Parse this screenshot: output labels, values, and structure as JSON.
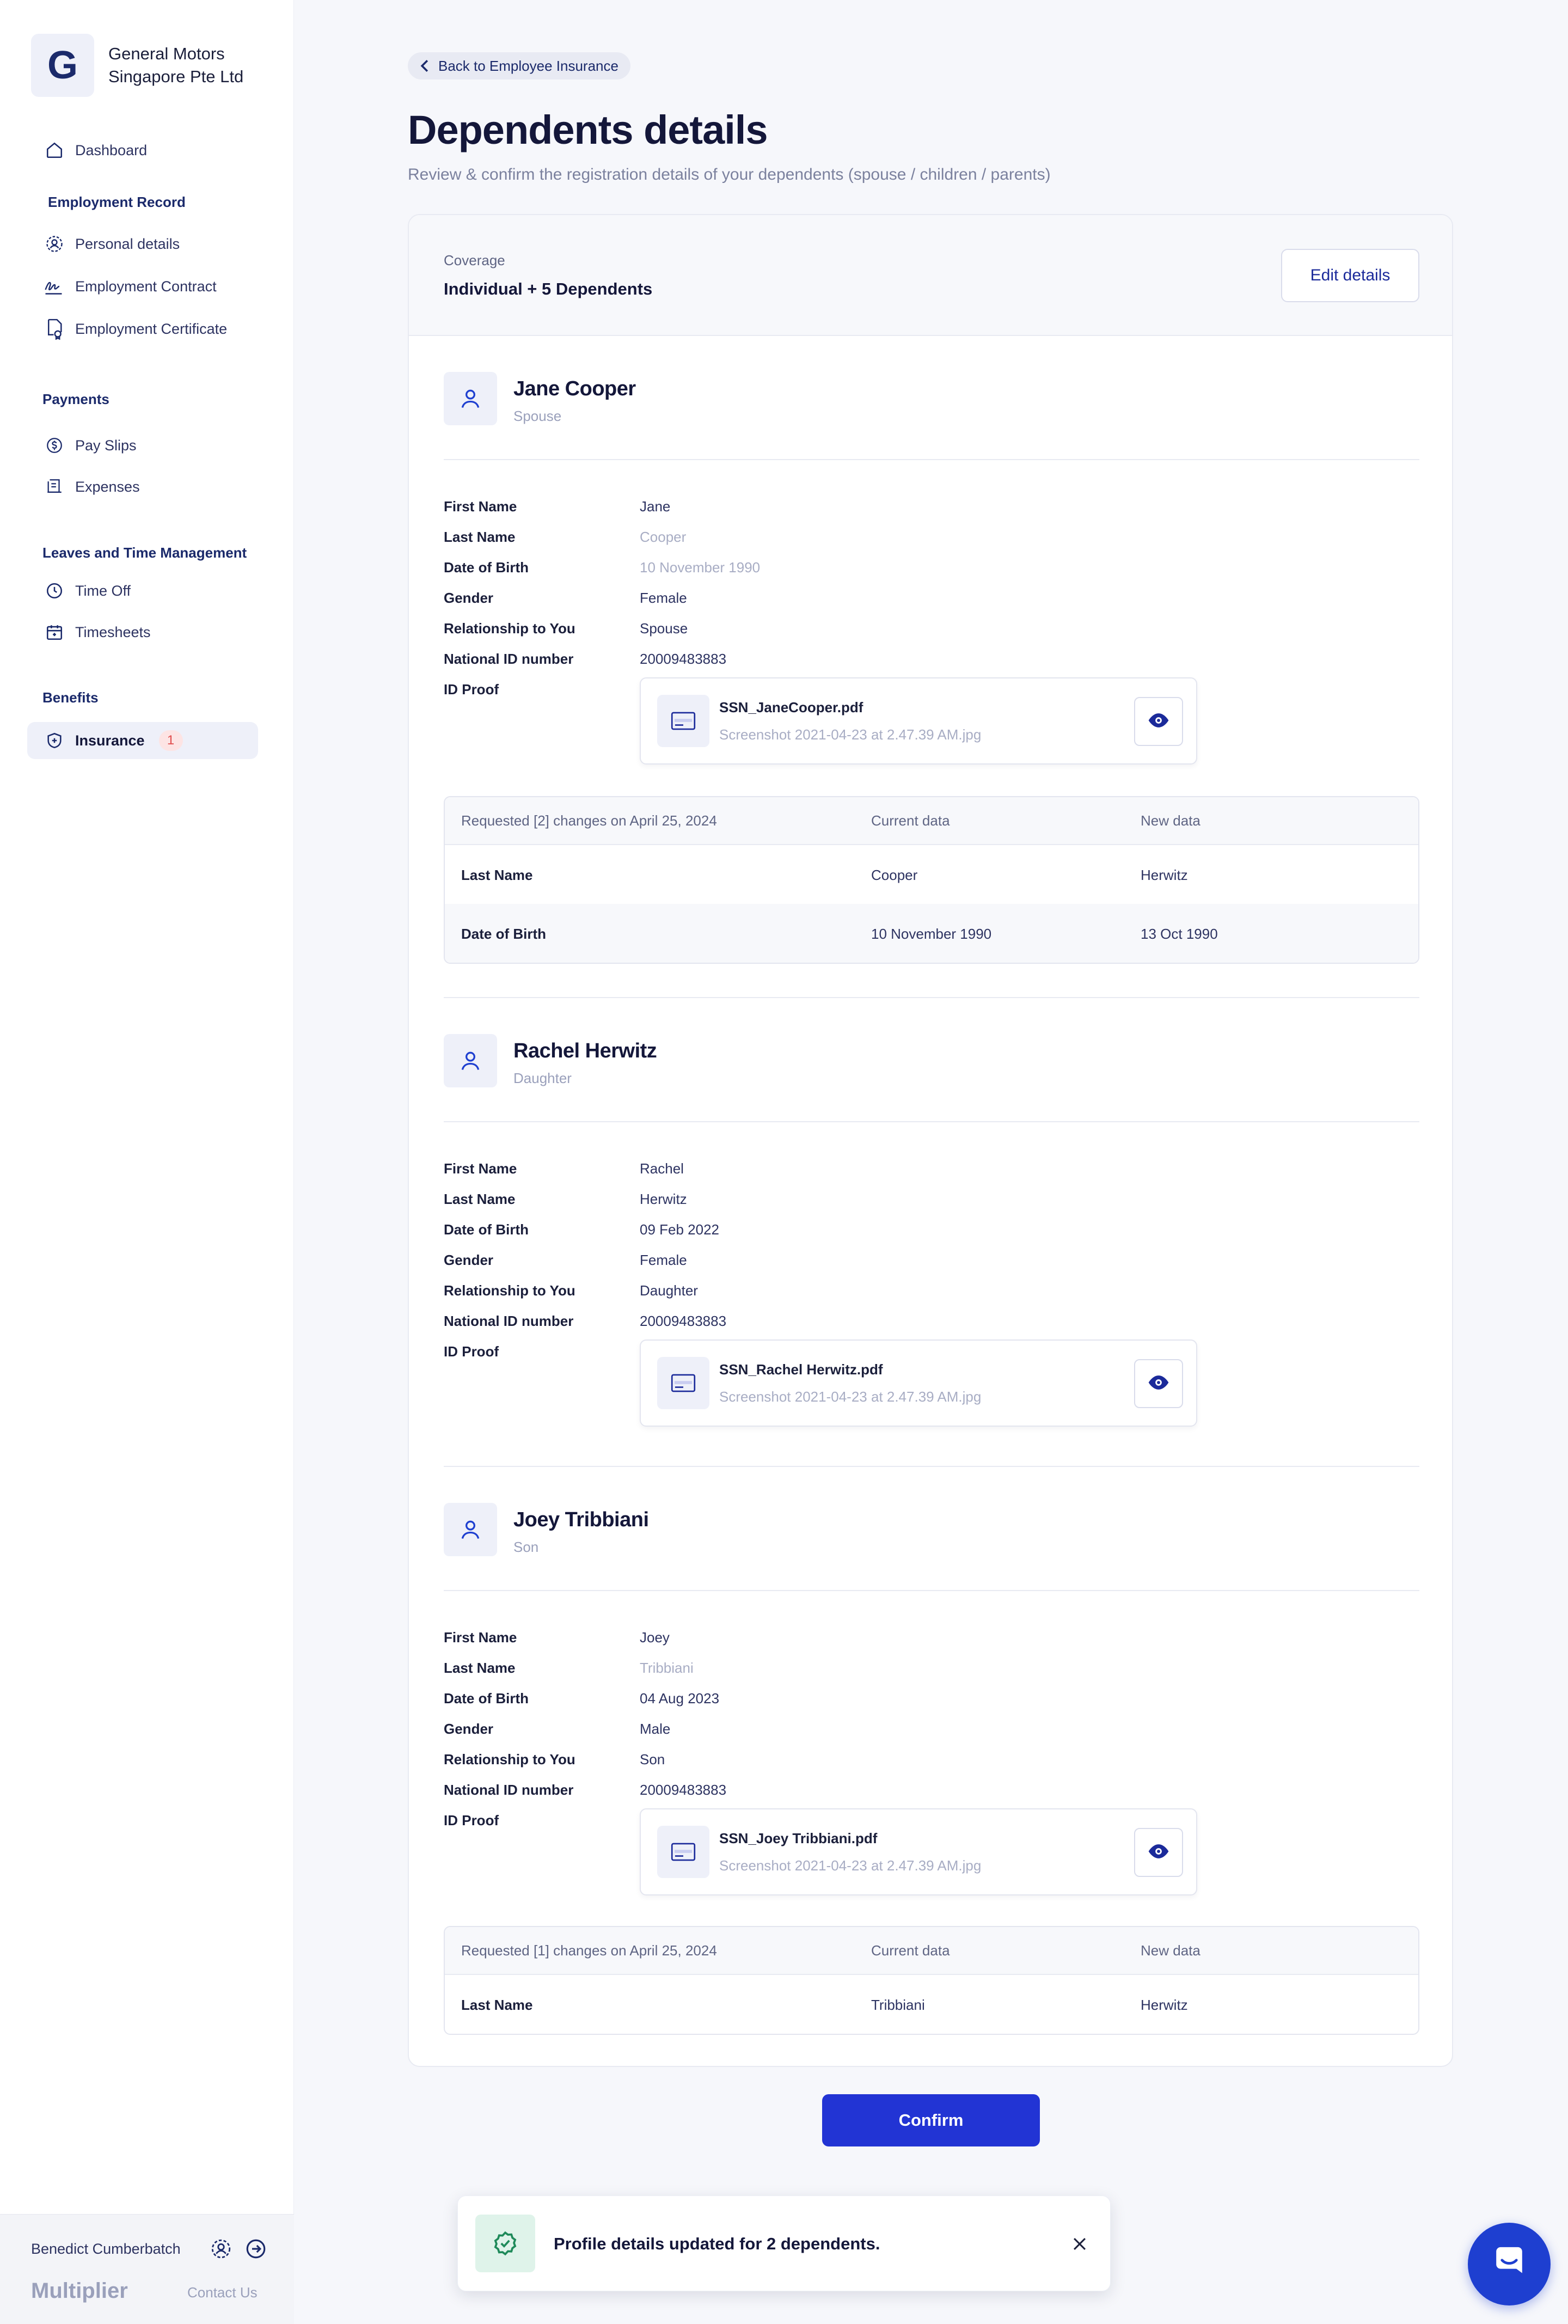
{
  "company": {
    "logo_letter": "G",
    "name_line1": "General Motors",
    "name_line2": "Singapore Pte Ltd"
  },
  "sidebar": {
    "dashboard": "Dashboard",
    "sections": {
      "employment": "Employment Record",
      "payments": "Payments",
      "leaves": "Leaves and Time Management",
      "benefits": "Benefits"
    },
    "items": {
      "personal_details": "Personal details",
      "employment_contract": "Employment Contract",
      "employment_certificate": "Employment Certificate",
      "pay_slips": "Pay Slips",
      "expenses": "Expenses",
      "time_off": "Time Off",
      "timesheets": "Timesheets",
      "insurance": "Insurance",
      "insurance_badge": "1"
    },
    "footer": {
      "user_name": "Benedict Cumberbatch",
      "brand": "Multiplier",
      "contact": "Contact Us"
    }
  },
  "header": {
    "back_label": "Back to Employee Insurance",
    "title": "Dependents details",
    "subtitle": "Review & confirm the registration details of your dependents (spouse / children / parents)"
  },
  "coverage": {
    "label": "Coverage",
    "value": "Individual + 5 Dependents",
    "edit_label": "Edit details"
  },
  "field_labels": {
    "first_name": "First Name",
    "last_name": "Last Name",
    "dob": "Date of Birth",
    "gender": "Gender",
    "relationship": "Relationship to You",
    "national_id": "National ID number",
    "id_proof": "ID Proof"
  },
  "change_headers": {
    "current": "Current data",
    "new": "New data"
  },
  "dependents": [
    {
      "name": "Jane Cooper",
      "relation": "Spouse",
      "first_name": "Jane",
      "last_name": "Cooper",
      "dob": "10 November 1990",
      "gender": "Female",
      "relationship": "Spouse",
      "national_id": "20009483883",
      "file_name": "SSN_JaneCooper.pdf",
      "file_sub": "Screenshot 2021-04-23 at 2.47.39 AM.jpg",
      "changes_title": "Requested [2] changes on April 25, 2024",
      "changes": [
        {
          "field": "Last Name",
          "current": "Cooper",
          "new": "Herwitz"
        },
        {
          "field": "Date of Birth",
          "current": "10 November 1990",
          "new": "13 Oct 1990"
        }
      ]
    },
    {
      "name": "Rachel Herwitz",
      "relation": "Daughter",
      "first_name": "Rachel",
      "last_name": "Herwitz",
      "dob": "09 Feb 2022",
      "gender": "Female",
      "relationship": "Daughter",
      "national_id": "20009483883",
      "file_name": "SSN_Rachel Herwitz.pdf",
      "file_sub": "Screenshot 2021-04-23 at 2.47.39 AM.jpg"
    },
    {
      "name": "Joey Tribbiani",
      "relation": "Son",
      "first_name": "Joey",
      "last_name": "Tribbiani",
      "dob": "04 Aug 2023",
      "gender": "Male",
      "relationship": "Son",
      "national_id": "20009483883",
      "file_name": "SSN_Joey Tribbiani.pdf",
      "file_sub": "Screenshot 2021-04-23 at 2.47.39 AM.jpg",
      "changes_title": "Requested [1] changes on April 25, 2024",
      "changes": [
        {
          "field": "Last Name",
          "current": "Tribbiani",
          "new": "Herwitz"
        }
      ]
    }
  ],
  "confirm_label": "Confirm",
  "toast": {
    "message": "Profile details updated for 2 dependents."
  },
  "colors": {
    "accent": "#2234d4",
    "brand_navy": "#1b2a6b",
    "success_bg": "#dff3ea",
    "badge_red": "#e04d4d"
  },
  "icons": {
    "dashboard": "home-icon",
    "personal": "user-gear-icon",
    "contract": "signature-icon",
    "certificate": "certificate-icon",
    "payslips": "coin-icon",
    "expenses": "receipt-icon",
    "timeoff": "clock-icon",
    "timesheets": "calendar-icon",
    "insurance": "shield-icon",
    "chat": "chat-icon"
  }
}
